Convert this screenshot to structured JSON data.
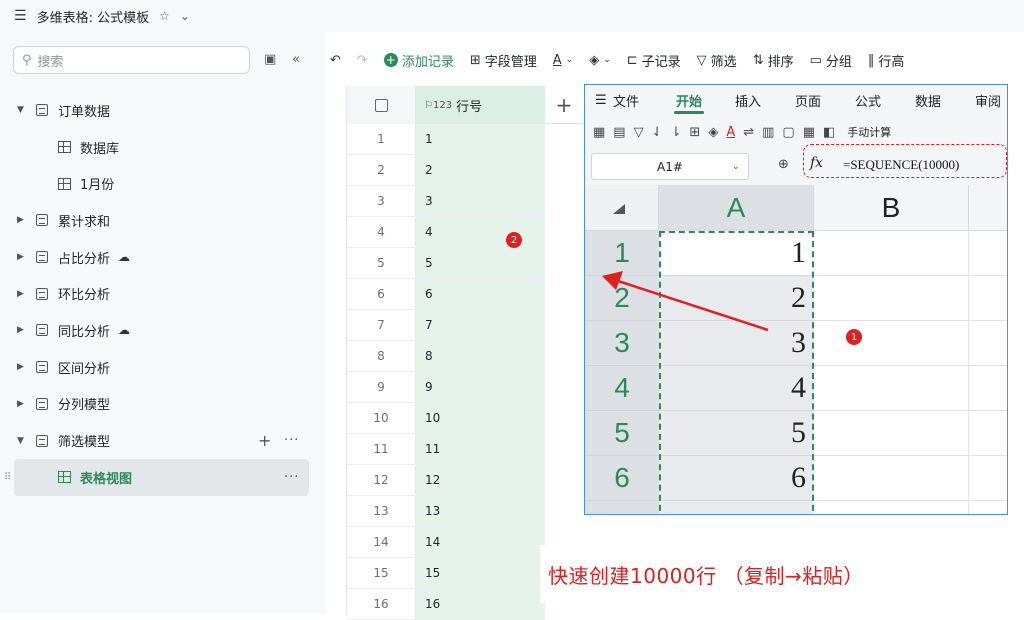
{
  "top_bar": {
    "menu_icon": "hamburger-icon",
    "title": "多维表格: 公式模板",
    "star": "☆",
    "caret": "⌄"
  },
  "sidebar": {
    "search_placeholder": "搜索",
    "items": [
      {
        "label": "订单数据",
        "type": "table",
        "expanded": true
      },
      {
        "label": "数据库",
        "type": "grid",
        "child": true
      },
      {
        "label": "1月份",
        "type": "grid",
        "child": true
      },
      {
        "label": "累计求和",
        "type": "table"
      },
      {
        "label": "占比分析",
        "type": "table",
        "cloud": true
      },
      {
        "label": "环比分析",
        "type": "table"
      },
      {
        "label": "同比分析",
        "type": "table",
        "cloud": true
      },
      {
        "label": "区间分析",
        "type": "table"
      },
      {
        "label": "分列模型",
        "type": "table"
      },
      {
        "label": "筛选模型",
        "type": "table",
        "expanded": true
      },
      {
        "label": "表格视图",
        "type": "grid",
        "child": true,
        "active": true
      }
    ]
  },
  "toolbar": {
    "undo": "↶",
    "redo": "↷",
    "add_record": "添加记录",
    "field_manage": "字段管理",
    "sub_record": "子记录",
    "filter": "筛选",
    "sort": "排序",
    "group": "分组",
    "row_height": "行高"
  },
  "grid": {
    "column_title": "行号",
    "column_type": "123",
    "rows": [
      {
        "num": "1",
        "val": "1"
      },
      {
        "num": "2",
        "val": "2"
      },
      {
        "num": "3",
        "val": "3"
      },
      {
        "num": "4",
        "val": "4"
      },
      {
        "num": "5",
        "val": "5"
      },
      {
        "num": "6",
        "val": "6"
      },
      {
        "num": "7",
        "val": "7"
      },
      {
        "num": "8",
        "val": "8"
      },
      {
        "num": "9",
        "val": "9"
      },
      {
        "num": "10",
        "val": "10"
      },
      {
        "num": "11",
        "val": "11"
      },
      {
        "num": "12",
        "val": "12"
      },
      {
        "num": "13",
        "val": "13"
      },
      {
        "num": "14",
        "val": "14"
      },
      {
        "num": "15",
        "val": "15"
      },
      {
        "num": "16",
        "val": "16"
      }
    ]
  },
  "spreadsheet": {
    "menu": [
      "文件",
      "开始",
      "插入",
      "页面",
      "公式",
      "数据",
      "审阅"
    ],
    "active_menu": "开始",
    "manual_calc": "手动计算",
    "name_box": "A1#",
    "fx": "fx",
    "formula": "=SEQUENCE(10000)",
    "col_headers": [
      "A",
      "B"
    ],
    "row_headers": [
      "1",
      "2",
      "3",
      "4",
      "5",
      "6"
    ],
    "col_a_values": [
      "1",
      "2",
      "3",
      "4",
      "5",
      "6"
    ]
  },
  "annotations": {
    "marker_1": "1",
    "marker_2": "2",
    "caption": "快速创建10000行 （复制→粘贴）"
  },
  "colors": {
    "accent": "#2b8a5a",
    "annotation_red": "#e02020",
    "selection_border": "#4a90e2"
  }
}
